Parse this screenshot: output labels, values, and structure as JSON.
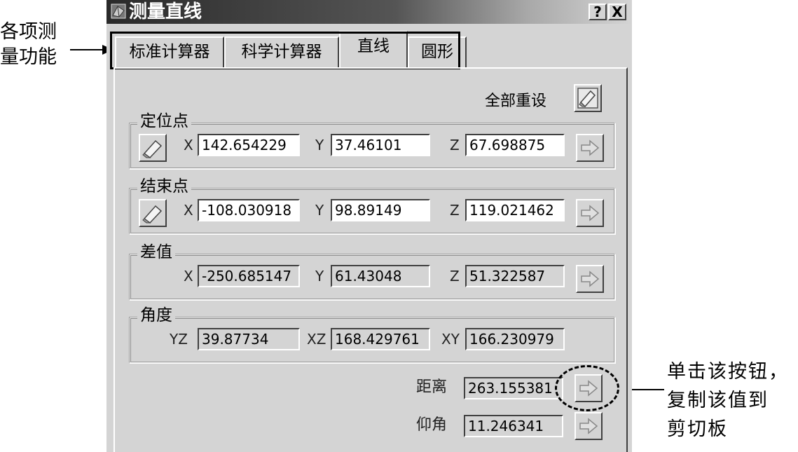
{
  "annotations": {
    "left_line1": "各项测",
    "left_line2": "量功能",
    "right_line1": "单击该按钮，",
    "right_line2": "复制该值到",
    "right_line3": "剪切板"
  },
  "window": {
    "title": "测量直线",
    "help_label": "?",
    "close_label": "X"
  },
  "tabs": [
    {
      "label": "标准计算器"
    },
    {
      "label": "科学计算器"
    },
    {
      "label": "直线",
      "active": true
    },
    {
      "label": "圆形"
    }
  ],
  "reset_all_label": "全部重设",
  "origin": {
    "title": "定位点",
    "x_label": "X",
    "x": "142.654229",
    "y_label": "Y",
    "y": "37.46101",
    "z_label": "Z",
    "z": "67.698875"
  },
  "end": {
    "title": "结束点",
    "x_label": "X",
    "x": "-108.030918",
    "y_label": "Y",
    "y": "98.89149",
    "z_label": "Z",
    "z": "119.021462"
  },
  "delta": {
    "title": "差值",
    "x_label": "X",
    "x": "-250.685147",
    "y_label": "Y",
    "y": "61.43048",
    "z_label": "Z",
    "z": "51.322587"
  },
  "angle": {
    "title": "角度",
    "yz_label": "YZ",
    "yz": "39.87734",
    "xz_label": "XZ",
    "xz": "168.429761",
    "xy_label": "XY",
    "xy": "166.230979"
  },
  "distance": {
    "label": "距离",
    "value": "263.155381"
  },
  "elevation": {
    "label": "仰角",
    "value": "11.246341"
  },
  "colors": {
    "dialog_bg": "#d4d4d4",
    "title_dark": "#2a2a2a"
  }
}
